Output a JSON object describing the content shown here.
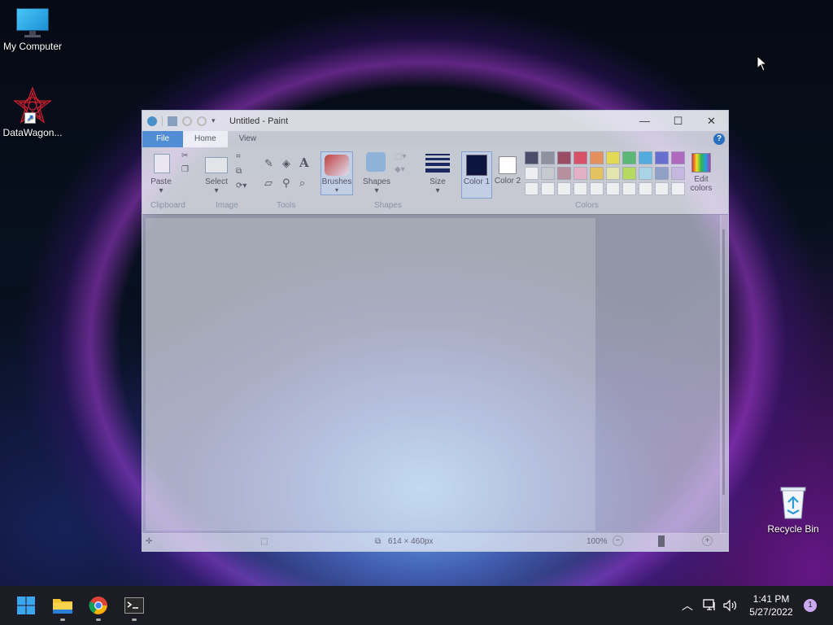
{
  "desktop": {
    "icons": [
      {
        "label": "My Computer"
      },
      {
        "label": "DataWagon..."
      },
      {
        "label": "Recycle Bin"
      }
    ]
  },
  "paint": {
    "title": "Untitled - Paint",
    "tabs": [
      "File",
      "Home",
      "View"
    ],
    "clipboard": {
      "paste": "Paste",
      "group": "Clipboard"
    },
    "image": {
      "select": "Select",
      "group": "Image"
    },
    "tools": {
      "group": "Tools",
      "text_tool": "A"
    },
    "brushes": "Brushes",
    "shapes": {
      "label": "Shapes",
      "group": "Shapes"
    },
    "size": "Size",
    "color1": "Color 1",
    "color2": "Color 2",
    "colors_group": "Colors",
    "edit_colors": "Edit colors",
    "palette_row1": [
      "#1a1a40",
      "#7a7a8a",
      "#8b1a3a",
      "#e0203a",
      "#f07830",
      "#f0e020",
      "#30b050",
      "#20a0e0",
      "#3a48c8",
      "#a040b0"
    ],
    "palette_row2": [
      "#ffffff",
      "#c8c8d0",
      "#b07888",
      "#f0a8c0",
      "#f0c030",
      "#f0f0a0",
      "#b0e030",
      "#a0d8f0",
      "#7890c0",
      "#c0b0e0"
    ],
    "palette_row3": [
      "#ffffff",
      "#ffffff",
      "#ffffff",
      "#ffffff",
      "#ffffff",
      "#ffffff",
      "#ffffff",
      "#ffffff",
      "#ffffff",
      "#ffffff"
    ],
    "color1_value": "#0c1440",
    "status": {
      "dimensions": "614 × 460px",
      "zoom": "100%"
    }
  },
  "taskbar": {
    "time": "1:41 PM",
    "date": "5/27/2022",
    "notifications": "1"
  }
}
